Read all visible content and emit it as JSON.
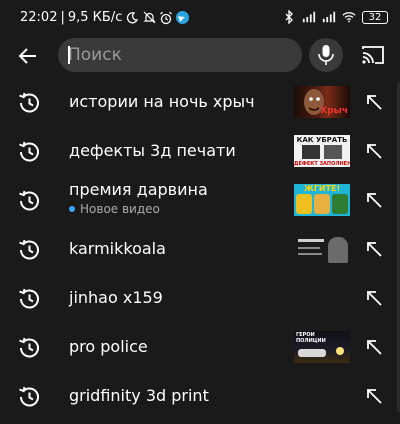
{
  "status_bar": {
    "time": "22:02",
    "speed": "9,5 КБ/с",
    "battery": "32"
  },
  "search": {
    "placeholder": "Поиск"
  },
  "history": [
    {
      "query": "истории на ночь хрыч",
      "thumb_text": "Хрыч"
    },
    {
      "query": "дефекты 3д печати",
      "thumb_text": [
        "КАК УБРАТЬ",
        "ДЕФЕКТ ЗАПОЛНЕНИЯ?"
      ]
    },
    {
      "query": "премия дарвина",
      "badge": "Новое видео",
      "thumb_text": "ЖГИТЕ!"
    },
    {
      "query": "karmikkoala"
    },
    {
      "query": "jinhao x159"
    },
    {
      "query": "pro police",
      "thumb_text": "ГЕРОИ ПОЛИЦИИ"
    },
    {
      "query": "gridfinity 3d print"
    }
  ],
  "colors": {
    "background": "#1a1a1a",
    "search_box": "#3a3a3a",
    "badge_dot": "#3ea6ff"
  }
}
